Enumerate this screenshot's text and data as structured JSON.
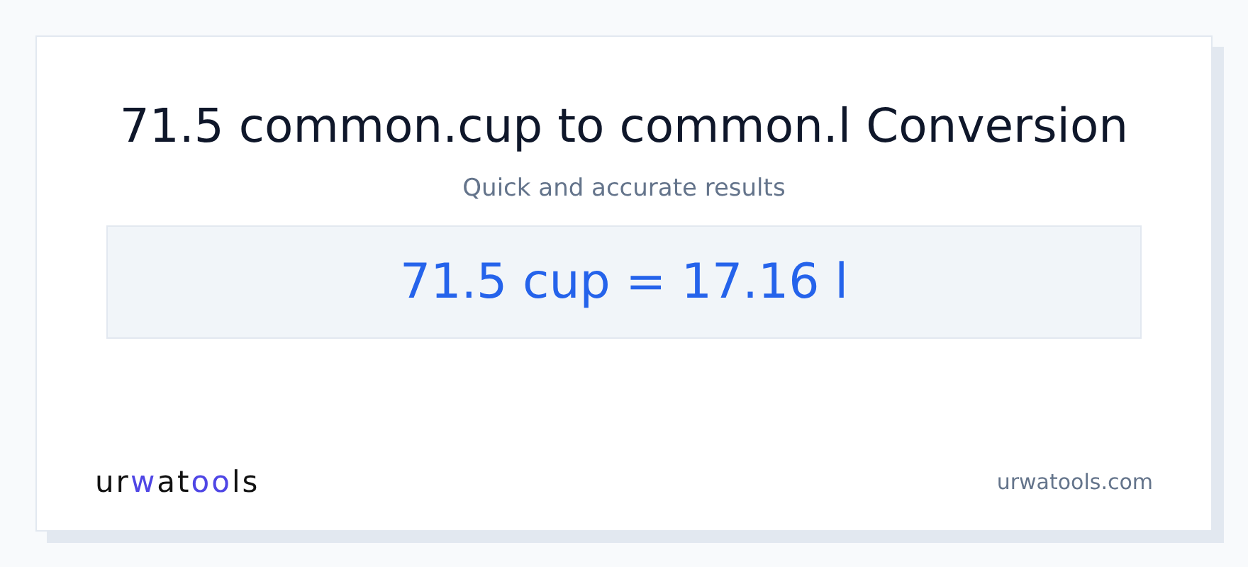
{
  "title": "71.5 common.cup to common.l Conversion",
  "subtitle": "Quick and accurate results",
  "result": "71.5 cup = 17.16 l",
  "logo": {
    "parts": [
      {
        "text": "ur",
        "accent": false
      },
      {
        "text": "w",
        "accent": true
      },
      {
        "text": "at",
        "accent": false
      },
      {
        "text": "oo",
        "accent": true
      },
      {
        "text": "ls",
        "accent": false
      }
    ]
  },
  "site": "urwatools.com"
}
